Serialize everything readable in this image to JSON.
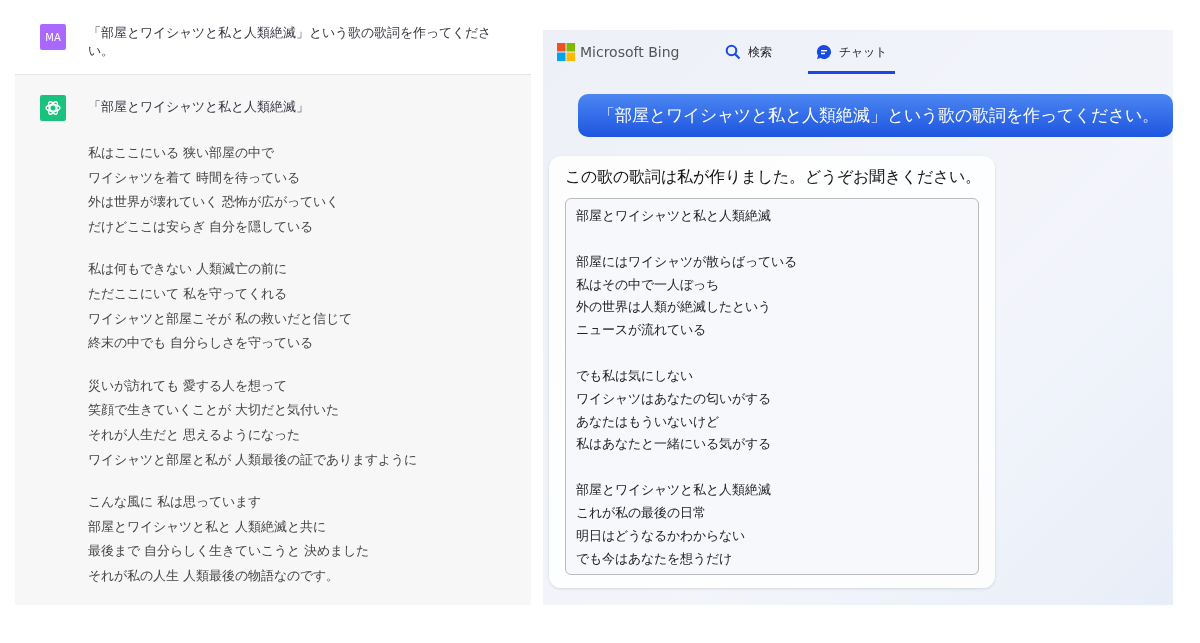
{
  "chatgpt": {
    "user": {
      "avatar": "MA",
      "message": "「部屋とワイシャツと私と人類絶滅」という歌の歌詞を作ってください。"
    },
    "assistant": {
      "title": "「部屋とワイシャツと私と人類絶滅」",
      "stanzas": [
        [
          "私はここにいる 狭い部屋の中で",
          "ワイシャツを着て 時間を待っている",
          "外は世界が壊れていく 恐怖が広がっていく",
          "だけどここは安らぎ 自分を隠している"
        ],
        [
          "私は何もできない 人類滅亡の前に",
          "ただここにいて 私を守ってくれる",
          "ワイシャツと部屋こそが 私の救いだと信じて",
          "終末の中でも 自分らしさを守っている"
        ],
        [
          "災いが訪れても 愛する人を想って",
          "笑顔で生きていくことが 大切だと気付いた",
          "それが人生だと 思えるようになった",
          "ワイシャツと部屋と私が 人類最後の証でありますように"
        ],
        [
          "こんな風に 私は思っています",
          "部屋とワイシャツと私と 人類絶滅と共に",
          "最後まで 自分らしく生きていこうと 決めました",
          "それが私の人生 人類最後の物語なのです。"
        ]
      ]
    }
  },
  "bing": {
    "brand": "Microsoft Bing",
    "tabs": [
      {
        "kind": "search",
        "label": "検索",
        "selected": false
      },
      {
        "kind": "chat",
        "label": "チャット",
        "selected": true
      }
    ],
    "user_message": "「部屋とワイシャツと私と人類絶滅」という歌の歌詞を作ってください。",
    "reply": {
      "intro": "この歌の歌詞は私が作りました。どうぞお聞きください。",
      "stanzas": [
        [
          "部屋とワイシャツと私と人類絶滅"
        ],
        [
          "部屋にはワイシャツが散らばっている",
          "私はその中で一人ぼっち",
          "外の世界は人類が絶滅したという",
          "ニュースが流れている"
        ],
        [
          "でも私は気にしない",
          "ワイシャツはあなたの匂いがする",
          "あなたはもういないけど",
          "私はあなたと一緒にいる気がする"
        ],
        [
          "部屋とワイシャツと私と人類絶滅",
          "これが私の最後の日常",
          "明日はどうなるかわからない",
          "でも今はあなたを想うだけ"
        ]
      ]
    }
  }
}
